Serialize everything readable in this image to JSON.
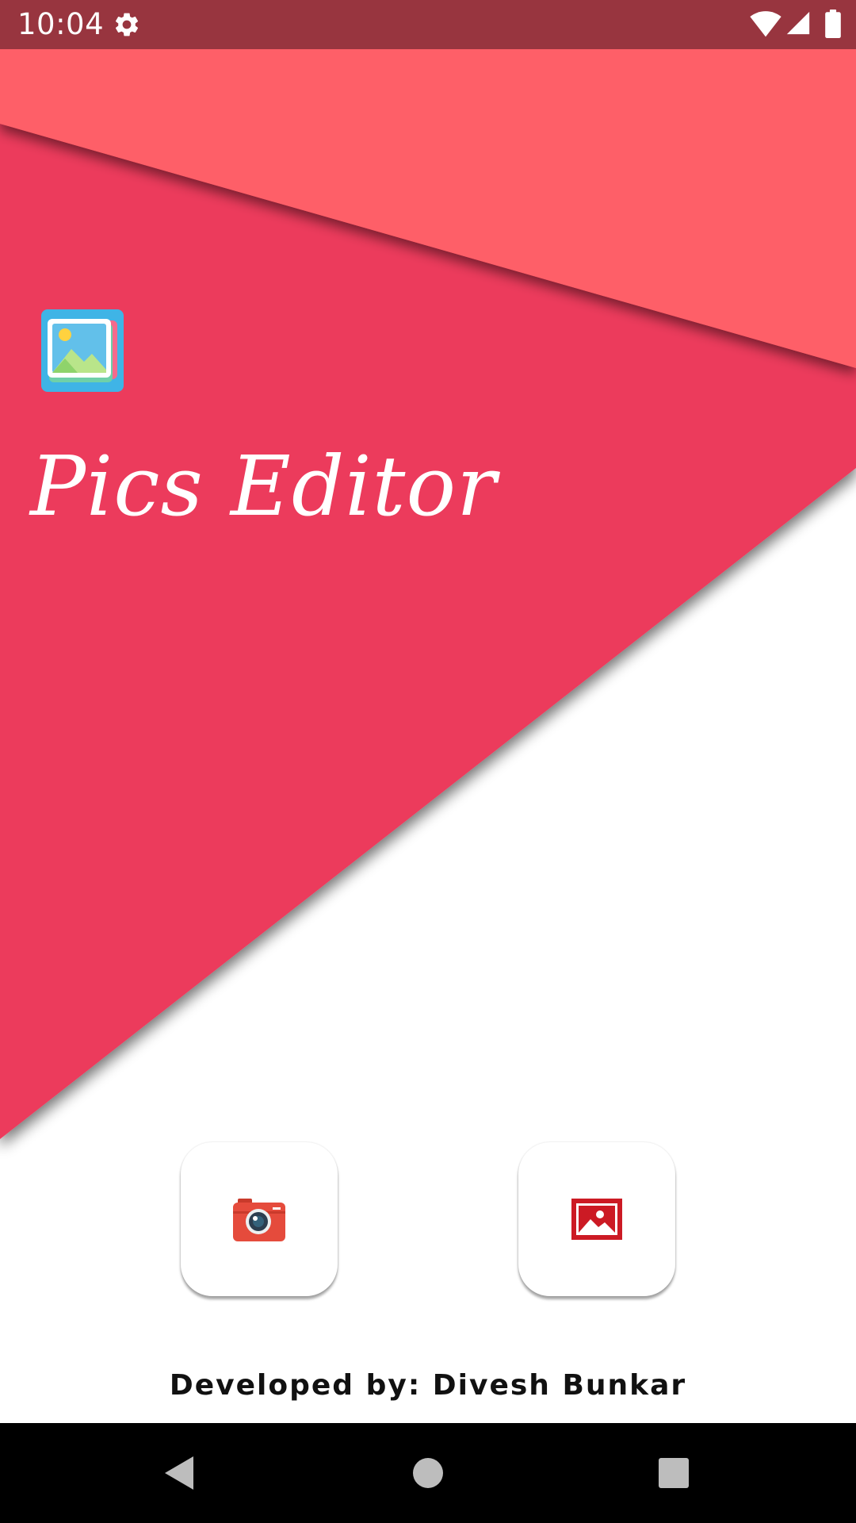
{
  "status_bar": {
    "time": "10:04",
    "icons": [
      "settings-icon",
      "wifi-icon",
      "cellular-signal-icon",
      "battery-icon"
    ],
    "color": "#98353f"
  },
  "app": {
    "title": "Pics Editor",
    "logo_icon": "photo-stack-icon",
    "colors": {
      "primary": "#ec3a5c",
      "secondary": "#fe5f67",
      "background": "#ffffff"
    }
  },
  "actions": {
    "camera_icon": "camera-icon",
    "gallery_icon": "gallery-image-icon"
  },
  "footer": {
    "credit": "Developed by: Divesh Bunkar"
  },
  "nav_bar": {
    "icons": [
      "back-icon",
      "home-icon",
      "recents-icon"
    ]
  }
}
